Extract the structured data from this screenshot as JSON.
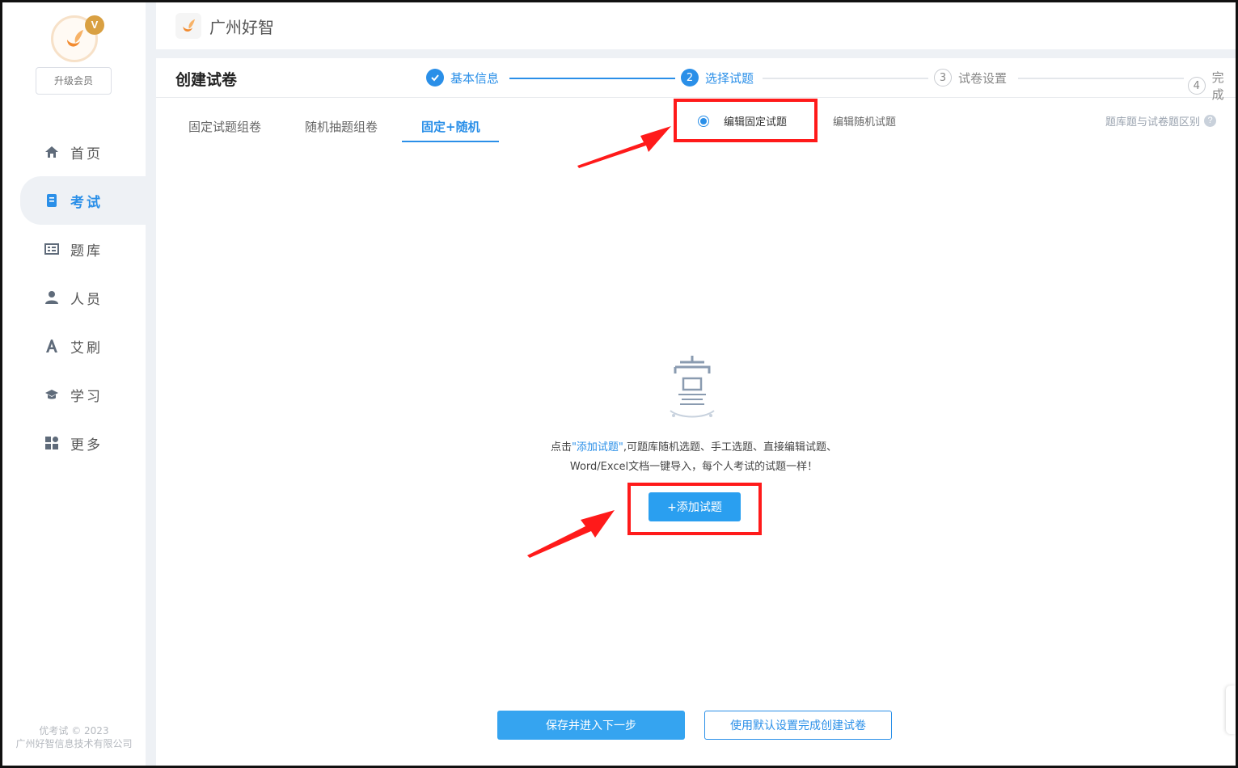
{
  "sidebar": {
    "upgrade_label": "升级会员",
    "vip_badge": "V",
    "items": [
      {
        "label": "首页",
        "icon": "home-icon",
        "active": false
      },
      {
        "label": "考试",
        "icon": "exam-icon",
        "active": true
      },
      {
        "label": "题库",
        "icon": "question-bank-icon",
        "active": false
      },
      {
        "label": "人员",
        "icon": "person-icon",
        "active": false
      },
      {
        "label": "艾刷",
        "icon": "font-a-icon",
        "active": false
      },
      {
        "label": "学习",
        "icon": "graduation-cap-icon",
        "active": false
      },
      {
        "label": "更多",
        "icon": "apps-grid-icon",
        "active": false
      }
    ],
    "copyright_line1": "优考试 © 2023",
    "copyright_line2": "广州好智信息技术有限公司"
  },
  "topbar": {
    "brand_name": "广州好智"
  },
  "page": {
    "title": "创建试卷"
  },
  "steps": [
    {
      "number": "✓",
      "label": "基本信息",
      "state": "done"
    },
    {
      "number": "2",
      "label": "选择试题",
      "state": "current"
    },
    {
      "number": "3",
      "label": "试卷设置",
      "state": "todo"
    },
    {
      "number": "4",
      "label": "完成",
      "state": "todo"
    }
  ],
  "tabs": [
    {
      "label": "固定试题组卷",
      "active": false
    },
    {
      "label": "随机抽题组卷",
      "active": false
    },
    {
      "label": "固定+随机",
      "active": true
    }
  ],
  "radio_options": [
    {
      "label": "编辑固定试题",
      "selected": true
    },
    {
      "label": "编辑随机试题",
      "selected": false
    }
  ],
  "help_link": "题库题与试卷题区别",
  "help_icon": "?",
  "empty_state": {
    "hint_prefix": "点击",
    "hint_link": "\"添加试题\"",
    "hint_suffix": ",可题库随机选题、手工选题、直接编辑试题、",
    "hint_line2": "Word/Excel文档一键导入，每个人考试的试题一样！",
    "add_button": "+添加试题"
  },
  "footer": {
    "save_button": "保存并进入下一步",
    "default_button": "使用默认设置完成创建试卷"
  },
  "colors": {
    "accent": "#2a8fe8",
    "annotation_red": "#ff1a1a"
  }
}
